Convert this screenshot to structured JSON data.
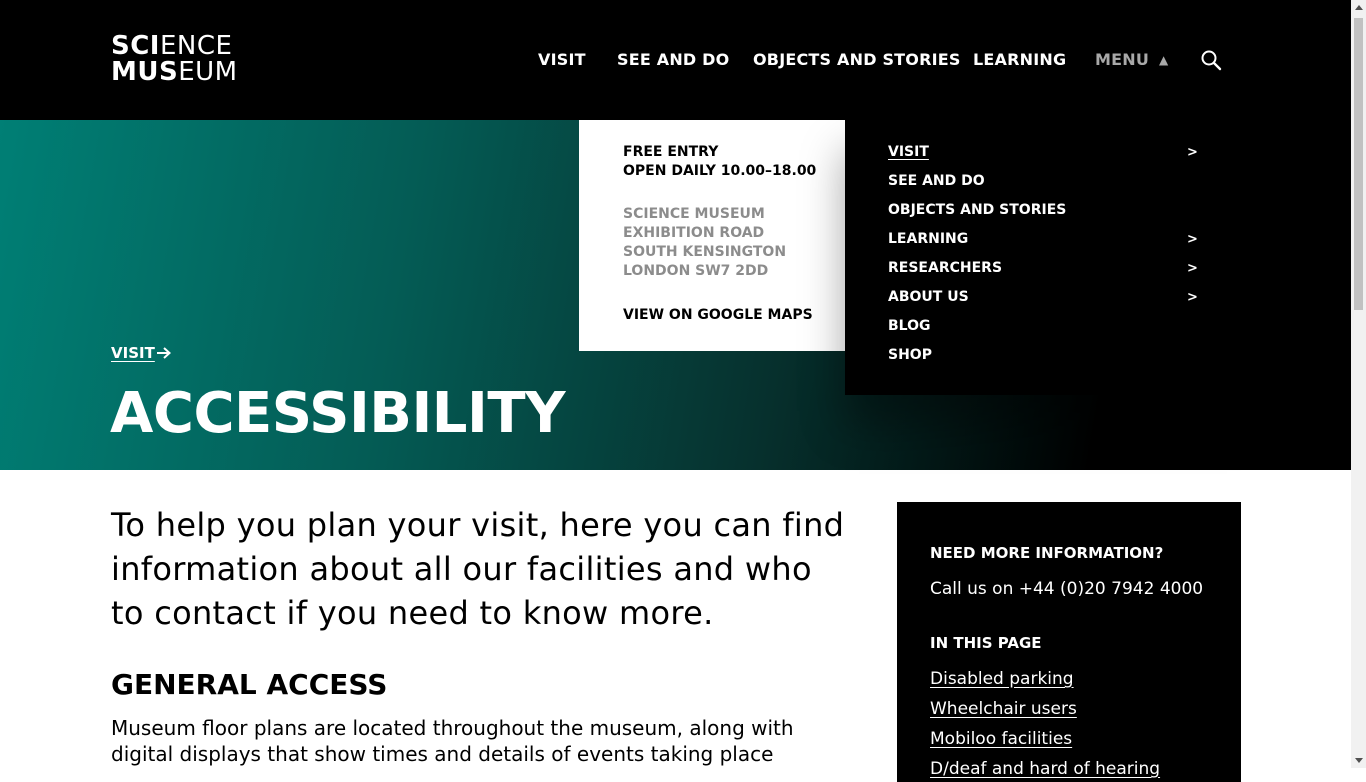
{
  "header": {
    "logo": {
      "line1_bold": "SCI",
      "line1_thin": "ENCE",
      "line2_bold": "MUS",
      "line2_thin": "EUM"
    },
    "nav": [
      "VISIT",
      "SEE AND DO",
      "OBJECTS AND STORIES",
      "LEARNING"
    ],
    "menu_label": "MENU",
    "menu_indicator": "▲",
    "search_icon": "search-icon"
  },
  "info_panel": {
    "entry": "FREE ENTRY",
    "hours": "OPEN DAILY 10.00–18.00",
    "address": [
      "SCIENCE MUSEUM",
      "EXHIBITION ROAD",
      "SOUTH KENSINGTON",
      "LONDON SW7 2DD"
    ],
    "maps_link": "VIEW ON GOOGLE MAPS"
  },
  "menu": {
    "items": [
      {
        "label": "VISIT",
        "has_submenu": true,
        "active": true
      },
      {
        "label": "SEE AND DO",
        "has_submenu": false
      },
      {
        "label": "OBJECTS AND STORIES",
        "has_submenu": false
      },
      {
        "label": "LEARNING",
        "has_submenu": true
      },
      {
        "label": "RESEARCHERS",
        "has_submenu": true
      },
      {
        "label": "ABOUT US",
        "has_submenu": true
      },
      {
        "label": "BLOG",
        "has_submenu": false
      },
      {
        "label": "SHOP",
        "has_submenu": false
      }
    ],
    "chevron": ">"
  },
  "hero": {
    "breadcrumb": "VISIT",
    "title": "ACCESSIBILITY",
    "gradient_start": "#007f75",
    "gradient_end": "#000000"
  },
  "main": {
    "intro": "To help you plan your visit, here you can find information about all our facilities and who to contact if you need to know more.",
    "section_heading": "GENERAL ACCESS",
    "body": "Museum floor plans are located throughout the museum, along with digital displays that show times and details of events taking place"
  },
  "sidebar": {
    "heading": "NEED MORE INFORMATION?",
    "phone": "Call us on +44 (0)20 7942 4000",
    "toc_heading": "IN THIS PAGE",
    "links": [
      "Disabled parking",
      "Wheelchair users",
      "Mobiloo facilities",
      "D/deaf and hard of hearing"
    ]
  }
}
